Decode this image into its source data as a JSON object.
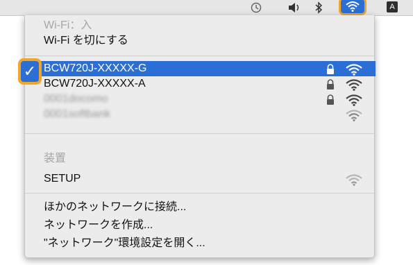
{
  "menubar": {
    "icons": [
      "time-machine-icon",
      "volume-icon",
      "bluetooth-icon",
      "wifi-icon",
      "input-source-icon"
    ],
    "input_source_label": "A"
  },
  "wifi_menu": {
    "status_label": "Wi-Fi：入",
    "toggle_label": "Wi-Fi を切にする",
    "networks": [
      {
        "name": "BCW720J-XXXXX-G",
        "selected": true,
        "locked": true
      },
      {
        "name": "BCW720J-XXXXX-A",
        "selected": false,
        "locked": true
      },
      {
        "name": "0001docomo",
        "selected": false,
        "locked": true
      },
      {
        "name": "0001softbank",
        "selected": false,
        "locked": false
      }
    ],
    "devices_header": "装置",
    "devices": [
      {
        "name": "SETUP"
      }
    ],
    "actions": {
      "join_other": "ほかのネットワークに接続...",
      "create_network": "ネットワークを作成...",
      "open_prefs": "\"ネットワーク\"環境設定を開く..."
    }
  },
  "colors": {
    "highlight": "#2b6fd6",
    "callout": "#f0a62a"
  }
}
